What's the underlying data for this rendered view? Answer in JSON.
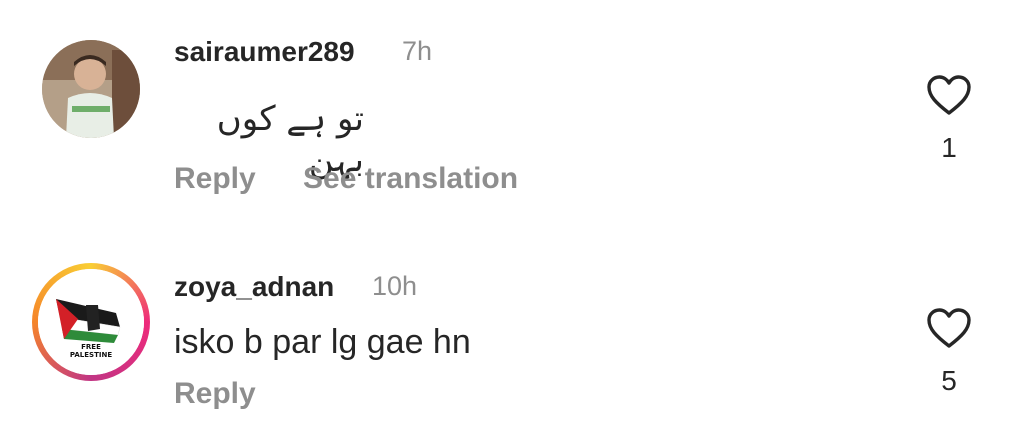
{
  "comments": [
    {
      "username": "sairaumer289",
      "time": "7h",
      "text": "تو ہے کوں بہن",
      "reply_label": "Reply",
      "translation_label": "See translation",
      "likes": "1"
    },
    {
      "username": "zoya_adnan",
      "time": "10h",
      "text": "isko b par lg gae hn",
      "reply_label": "Reply",
      "likes": "5",
      "avatar_text": [
        "FREE",
        "PALESTINE"
      ]
    }
  ],
  "icons": {
    "like": "heart-outline-icon"
  },
  "colors": {
    "text": "#262626",
    "muted": "#8e8e8e",
    "story_ring": [
      "#f9ce34",
      "#ee2a7b",
      "#c13584",
      "#f58529"
    ]
  }
}
